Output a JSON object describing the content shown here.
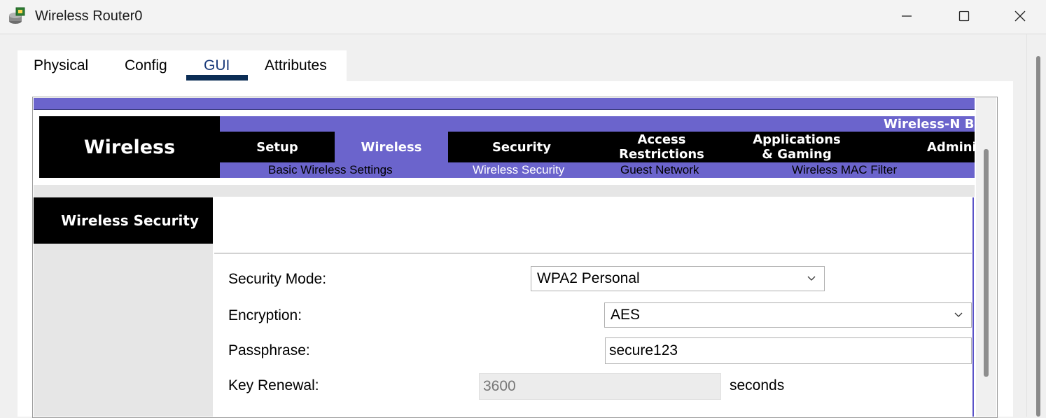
{
  "window": {
    "title": "Wireless Router0"
  },
  "tabs": [
    {
      "label": "Physical"
    },
    {
      "label": "Config"
    },
    {
      "label": "GUI",
      "active": true
    },
    {
      "label": "Attributes"
    }
  ],
  "router": {
    "brand_label": "Wireless",
    "model_label": "Wireless-N B",
    "menu": {
      "setup": "Setup",
      "wireless": "Wireless",
      "security": "Security",
      "access_line1": "Access",
      "access_line2": "Restrictions",
      "apps_line1": "Applications",
      "apps_line2": "& Gaming",
      "admin": "Admini"
    },
    "submenu": {
      "basic": "Basic Wireless Settings",
      "wireless_security": "Wireless Security",
      "guest": "Guest Network",
      "mac_filter": "Wireless MAC Filter"
    },
    "section_title": "Wireless Security",
    "form": {
      "security_mode_label": "Security Mode:",
      "security_mode_value": "WPA2 Personal",
      "encryption_label": "Encryption:",
      "encryption_value": "AES",
      "passphrase_label": "Passphrase:",
      "passphrase_value": "secure123",
      "key_renewal_label": "Key Renewal:",
      "key_renewal_value": "3600",
      "key_renewal_unit": "seconds"
    }
  },
  "colors": {
    "accent": "#6b64cc",
    "menu_bg": "#000000",
    "tab_underline": "#0b2d55"
  }
}
